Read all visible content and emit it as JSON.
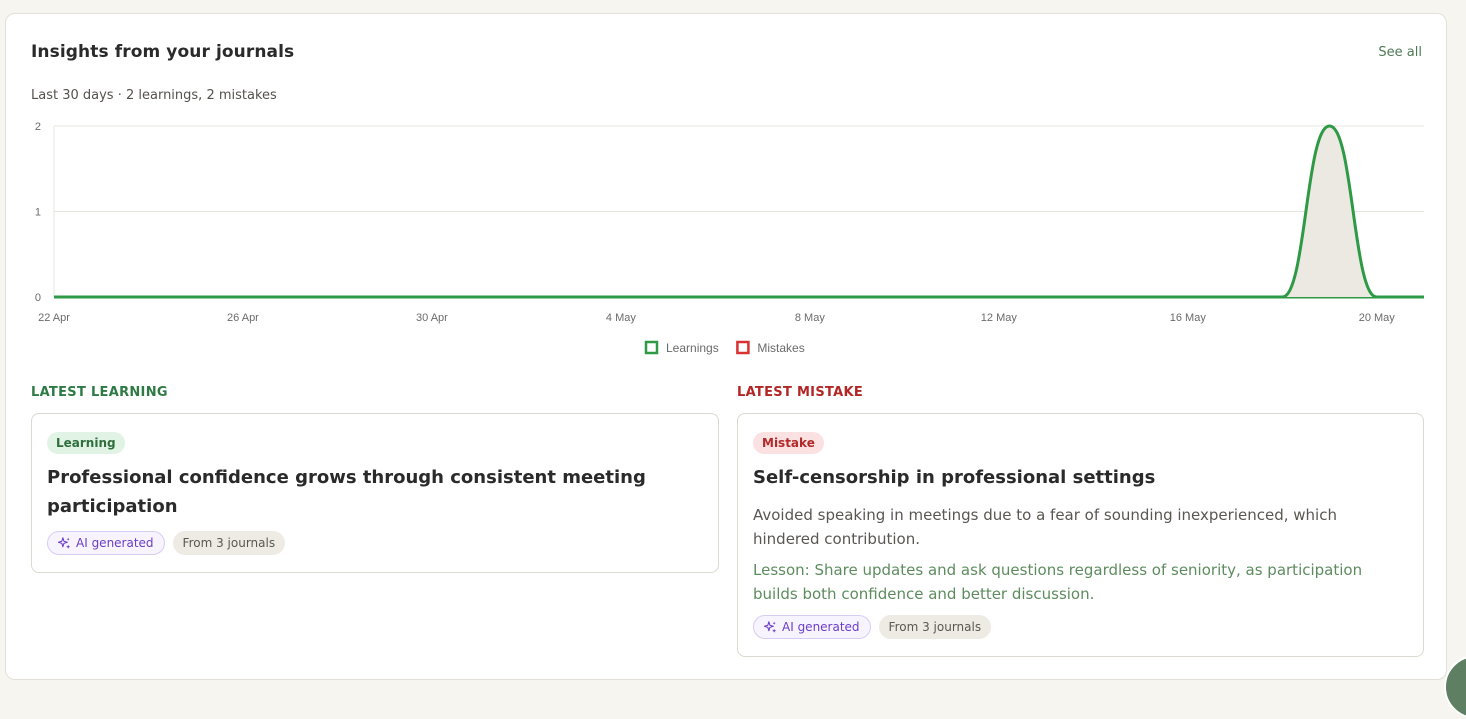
{
  "header": {
    "title": "Insights from your journals",
    "see_all": "See all",
    "subtitle": "Last 30 days · 2 learnings, 2 mistakes"
  },
  "colors": {
    "learning": "#2e9a45",
    "mistake": "#d93232",
    "area_fill": "#ece9e2",
    "grid": "#e6e4de",
    "axis_text": "#6b6b6b"
  },
  "chart_data": {
    "type": "line",
    "x": [
      "22 Apr",
      "23 Apr",
      "24 Apr",
      "25 Apr",
      "26 Apr",
      "27 Apr",
      "28 Apr",
      "29 Apr",
      "30 Apr",
      "1 May",
      "2 May",
      "3 May",
      "4 May",
      "5 May",
      "6 May",
      "7 May",
      "8 May",
      "9 May",
      "10 May",
      "11 May",
      "12 May",
      "13 May",
      "14 May",
      "15 May",
      "16 May",
      "17 May",
      "18 May",
      "19 May",
      "20 May",
      "21 May"
    ],
    "x_ticks": [
      "22 Apr",
      "26 Apr",
      "30 Apr",
      "4 May",
      "8 May",
      "12 May",
      "16 May",
      "20 May"
    ],
    "series": [
      {
        "name": "Learnings",
        "color": "#2e9a45",
        "values": [
          0,
          0,
          0,
          0,
          0,
          0,
          0,
          0,
          0,
          0,
          0,
          0,
          0,
          0,
          0,
          0,
          0,
          0,
          0,
          0,
          0,
          0,
          0,
          0,
          0,
          0,
          0,
          0,
          0,
          0
        ]
      },
      {
        "name": "Mistakes",
        "color": "#2e9a45",
        "values": [
          0,
          0,
          0,
          0,
          0,
          0,
          0,
          0,
          0,
          0,
          0,
          0,
          0,
          0,
          0,
          0,
          0,
          0,
          0,
          0,
          0,
          0,
          0,
          0,
          0,
          0,
          0,
          2,
          0,
          0
        ]
      }
    ],
    "ylim": [
      0,
      2
    ],
    "y_ticks": [
      0,
      1,
      2
    ],
    "grid": true,
    "legend_position": "bottom-center",
    "legend": [
      {
        "label": "Learnings",
        "color": "#2e9a45"
      },
      {
        "label": "Mistakes",
        "color": "#d93232"
      }
    ]
  },
  "latest_learning": {
    "section_label": "LATEST LEARNING",
    "tag": "Learning",
    "title": "Professional confidence grows through consistent meeting participation",
    "chip_ai": "AI generated",
    "chip_journals": "From 3 journals"
  },
  "latest_mistake": {
    "section_label": "LATEST MISTAKE",
    "tag": "Mistake",
    "title": "Self-censorship in professional settings",
    "description": "Avoided speaking in meetings due to a fear of sounding inexperienced, which hindered contribution.",
    "lesson": "Lesson: Share updates and ask questions regardless of seniority, as participation builds both confidence and better discussion.",
    "chip_ai": "AI generated",
    "chip_journals": "From 3 journals"
  }
}
